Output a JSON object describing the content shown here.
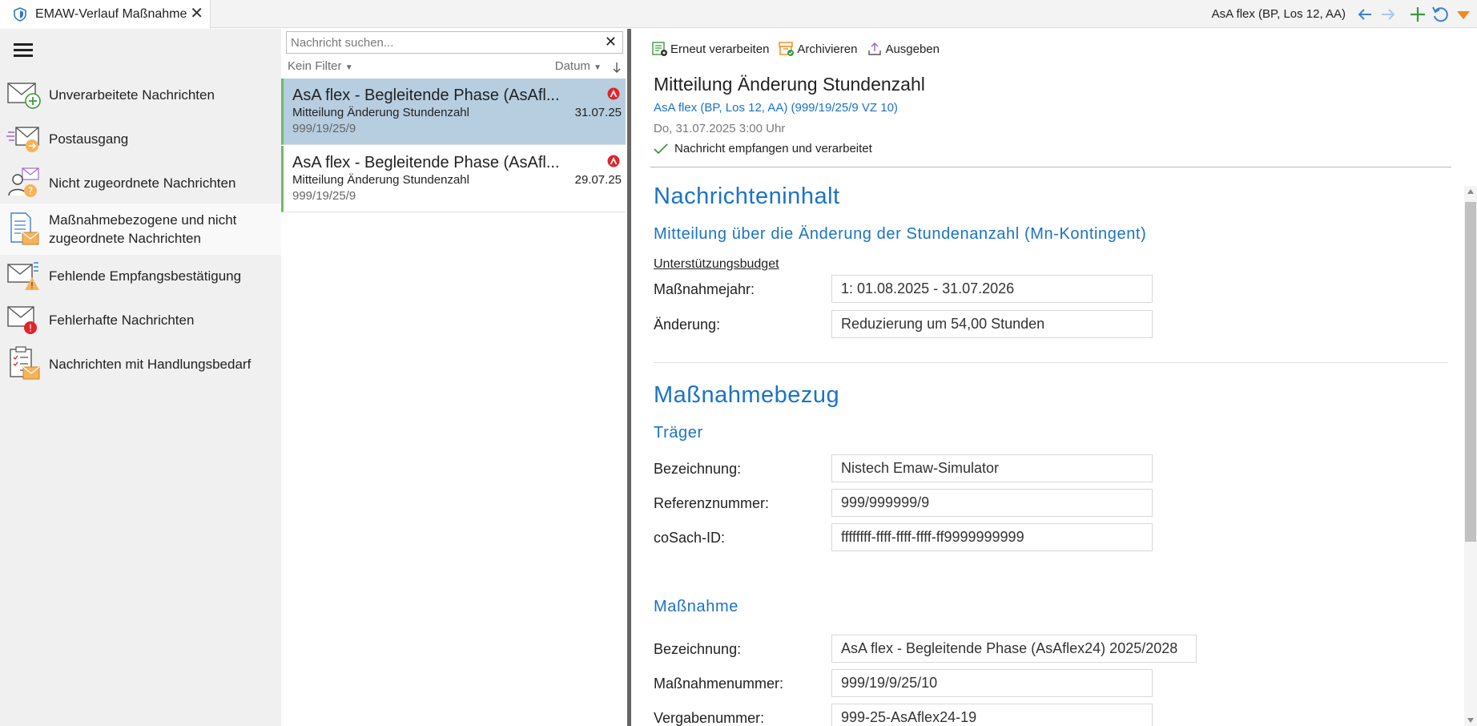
{
  "tab": {
    "title": "EMAW-Verlauf Maßnahme",
    "icon": "shield-icon",
    "close_icon": "close-icon"
  },
  "header": {
    "context_label": "AsA flex (BP, Los 12, AA)",
    "buttons": [
      "back-arrow-icon",
      "forward-arrow-icon",
      "add-icon",
      "refresh-icon",
      "dropdown-triangle-icon"
    ]
  },
  "sidebar": {
    "menu_icon": "hamburger-menu-icon",
    "items": [
      {
        "label": "Unverarbeitete Nachrichten",
        "icon": "envelope-plus-icon"
      },
      {
        "label": "Postausgang",
        "icon": "outbox-icon"
      },
      {
        "label": "Nicht zugeordnete Nachrichten",
        "icon": "person-question-icon"
      },
      {
        "label": "Maßnahmebezogene und nicht zugeordnete Nachrichten",
        "icon": "document-envelope-icon"
      },
      {
        "label": "Fehlende Empfangsbestätigung",
        "icon": "envelope-warning-icon"
      },
      {
        "label": "Fehlerhafte Nachrichten",
        "icon": "envelope-error-icon"
      },
      {
        "label": "Nachrichten mit Handlungsbedarf",
        "icon": "clipboard-envelope-icon"
      }
    ]
  },
  "list": {
    "search_placeholder": "Nachricht suchen...",
    "filter_label": "Kein Filter",
    "sort_label": "Datum",
    "messages": [
      {
        "title": "AsA flex - Begleitende Phase (AsAfl...",
        "subject": "Mitteilung Änderung Stundenzahl",
        "id": "999/19/25/9",
        "date": "31.07.25",
        "selected": true,
        "badge": "agency-logo-icon"
      },
      {
        "title": "AsA flex - Begleitende Phase (AsAfl...",
        "subject": "Mitteilung Änderung Stundenzahl",
        "id": "999/19/25/9",
        "date": "29.07.25",
        "selected": false,
        "badge": "agency-logo-icon"
      }
    ]
  },
  "detail": {
    "toolbar": {
      "reprocess": "Erneut verarbeiten",
      "archive": "Archivieren",
      "export": "Ausgeben"
    },
    "title": "Mitteilung Änderung Stundenzahl",
    "link": "AsA flex (BP, Los 12, AA) (999/19/25/9 VZ 10)",
    "date": "Do, 31.07.2025 3:00 Uhr",
    "status": "Nachricht empfangen und verarbeitet",
    "section1": {
      "heading": "Nachrichteninhalt",
      "subheading": "Mitteilung über die Änderung der Stundenanzahl (Mn-Kontingent)",
      "group": "Unterstützungsbudget",
      "fields": [
        {
          "label": "Maßnahmejahr:",
          "value": "1: 01.08.2025 - 31.07.2026"
        },
        {
          "label": "Änderung:",
          "value": "Reduzierung um 54,00 Stunden"
        }
      ]
    },
    "section2": {
      "heading": "Maßnahmebezug",
      "traeger": {
        "heading": "Träger",
        "fields": [
          {
            "label": "Bezeichnung:",
            "value": "Nistech Emaw-Simulator"
          },
          {
            "label": "Referenznummer:",
            "value": "999/999999/9"
          },
          {
            "label": "coSach-ID:",
            "value": "ffffffff-ffff-ffff-ffff-ff9999999999"
          }
        ]
      },
      "massnahme": {
        "heading": "Maßnahme",
        "fields": [
          {
            "label": "Bezeichnung:",
            "value": "AsA flex - Begleitende Phase (AsAflex24) 2025/2028"
          },
          {
            "label": "Maßnahmenummer:",
            "value": "999/19/9/25/10"
          },
          {
            "label": "Vergabenummer:",
            "value": "999-25-AsAflex24-19"
          }
        ]
      }
    }
  },
  "colors": {
    "accent_blue": "#1a73c6",
    "selected_row": "#b6cee0",
    "success_green": "#3c9a3c",
    "error_red": "#e0242b",
    "warning_orange": "#f08a1c"
  }
}
